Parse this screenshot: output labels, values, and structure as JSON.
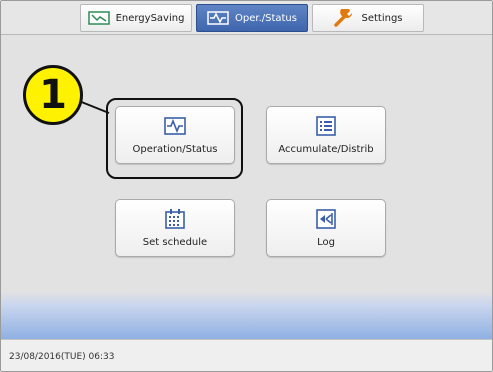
{
  "tabs": [
    {
      "label": "EnergySaving",
      "icon": "energy-saving-icon",
      "active": false
    },
    {
      "label": "Oper./Status",
      "icon": "operation-status-icon",
      "active": true
    },
    {
      "label": "Settings",
      "icon": "wrench-icon",
      "active": false
    }
  ],
  "menu": {
    "operation_status": "Operation/Status",
    "accumulate_distrib": "Accumulate/Distrib",
    "set_schedule": "Set schedule",
    "log": "Log"
  },
  "callout": {
    "number": "1"
  },
  "status": {
    "datetime": "23/08/2016(TUE) 06:33"
  },
  "colors": {
    "active_tab": "#4a70b5",
    "callout_fill": "#fff200",
    "icon_blue": "#3a5fa8",
    "energy_green": "#2e8b57",
    "settings_orange": "#e07a10"
  }
}
